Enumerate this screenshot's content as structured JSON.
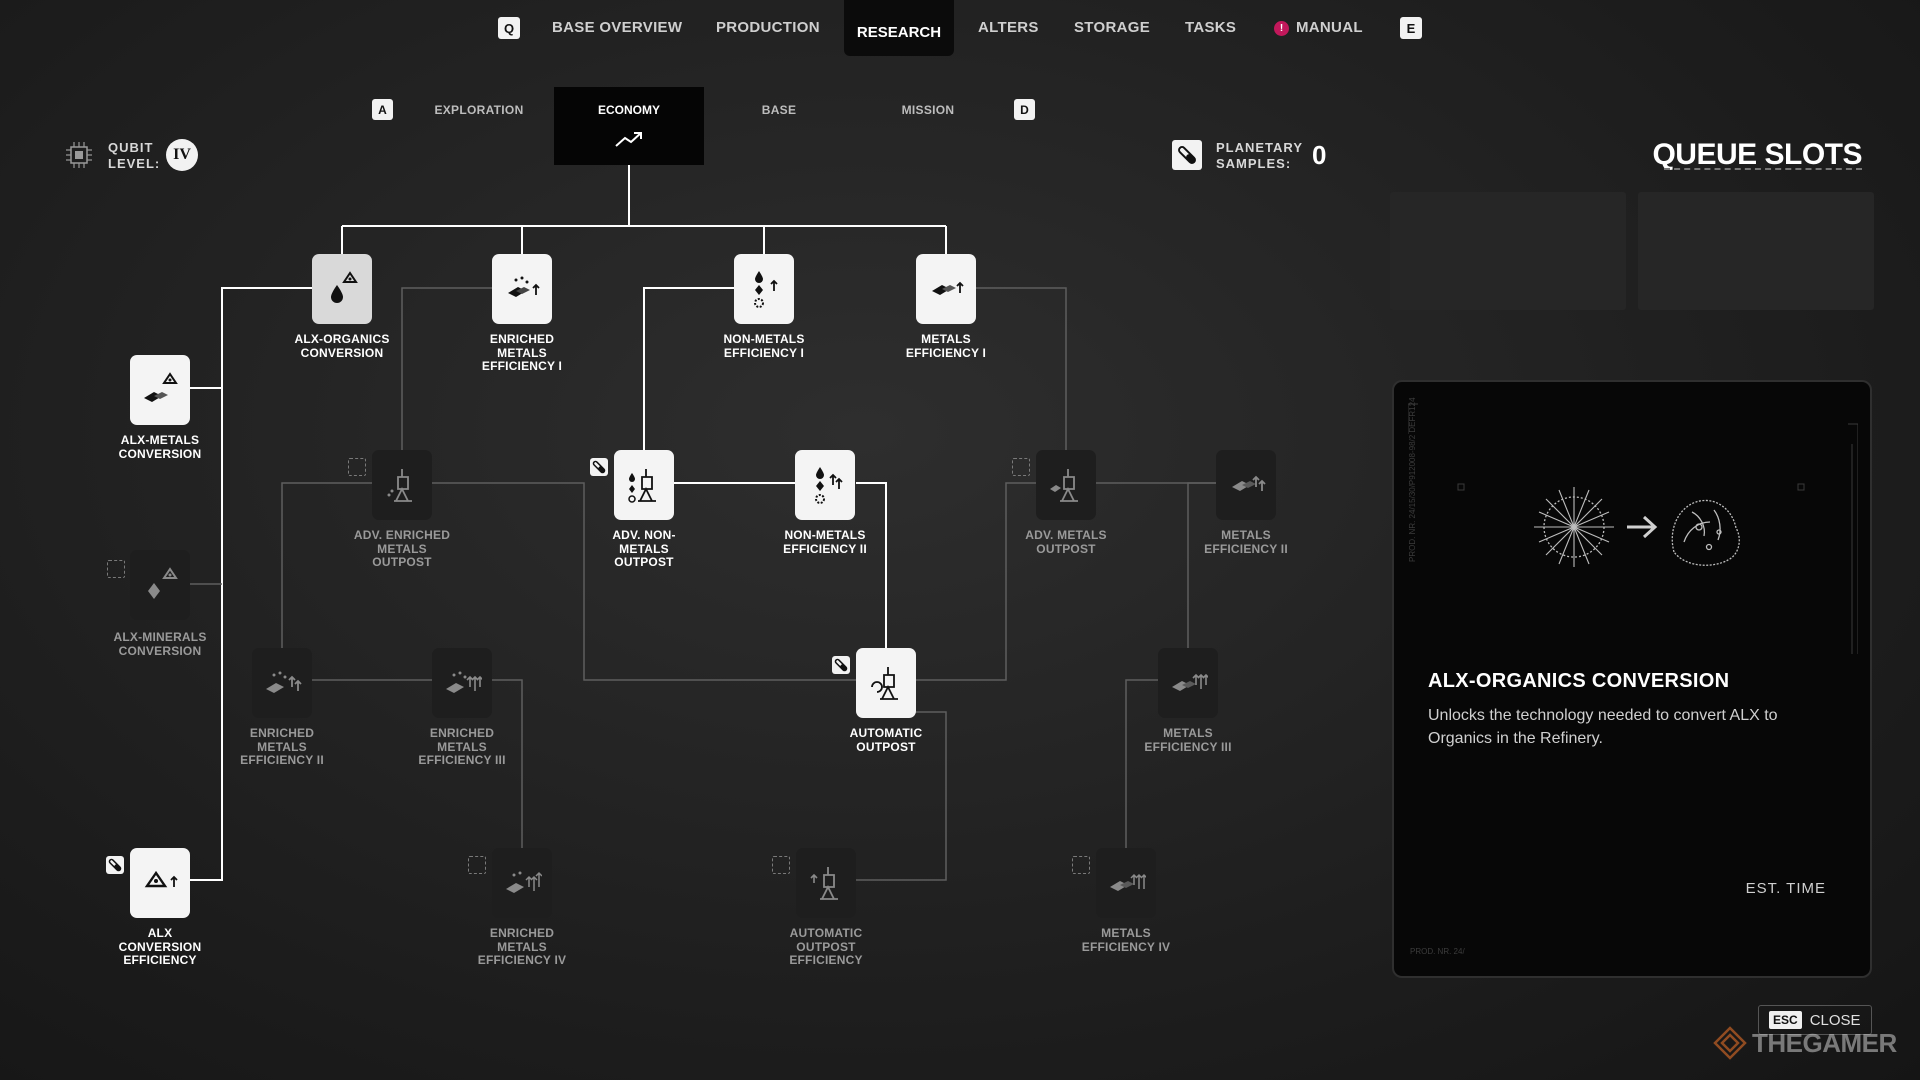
{
  "top_nav": {
    "left_key": "Q",
    "right_key": "E",
    "items": [
      "BASE OVERVIEW",
      "PRODUCTION",
      "RESEARCH",
      "ALTERS",
      "STORAGE",
      "TASKS",
      "MANUAL"
    ],
    "active": "RESEARCH",
    "manual_badge": "!"
  },
  "sub_nav": {
    "left_key": "A",
    "right_key": "D",
    "items": [
      "EXPLORATION",
      "ECONOMY",
      "BASE",
      "MISSION"
    ],
    "active": "ECONOMY"
  },
  "qubit": {
    "label": "QUBIT\nLEVEL:",
    "level": "IV"
  },
  "samples": {
    "label": "PLANETARY\nSAMPLES:",
    "count": "0"
  },
  "queue": {
    "title": "QUEUE SLOTS"
  },
  "nodes": [
    {
      "id": "alx-organics",
      "label": "ALX-ORGANICS\nCONVERSION",
      "unlocked": true,
      "selected": true,
      "icon": "organics-alx-icon"
    },
    {
      "id": "enriched-1",
      "label": "ENRICHED\nMETALS\nEFFICIENCY I",
      "unlocked": true,
      "icon": "enriched-metals-icon"
    },
    {
      "id": "nonmetals-1",
      "label": "NON-METALS\nEFFICIENCY I",
      "unlocked": true,
      "icon": "non-metals-icon"
    },
    {
      "id": "metals-1",
      "label": "METALS\nEFFICIENCY I",
      "unlocked": true,
      "icon": "metals-icon"
    },
    {
      "id": "alx-metals",
      "label": "ALX-METALS\nCONVERSION",
      "unlocked": true,
      "icon": "metals-alx-icon"
    },
    {
      "id": "adv-enriched-outpost",
      "label": "ADV. ENRICHED\nMETALS\nOUTPOST",
      "unlocked": false,
      "icon": "outpost-icon"
    },
    {
      "id": "adv-nonmetals-outpost",
      "label": "ADV. NON-\nMETALS\nOUTPOST",
      "unlocked": true,
      "icon": "outpost-icon"
    },
    {
      "id": "nonmetals-2",
      "label": "NON-METALS\nEFFICIENCY II",
      "unlocked": true,
      "icon": "non-metals-icon"
    },
    {
      "id": "adv-metals-outpost",
      "label": "ADV. METALS\nOUTPOST",
      "unlocked": false,
      "icon": "outpost-icon"
    },
    {
      "id": "metals-2",
      "label": "METALS\nEFFICIENCY II",
      "unlocked": false,
      "icon": "metals-icon"
    },
    {
      "id": "alx-minerals",
      "label": "ALX-MINERALS\nCONVERSION",
      "unlocked": false,
      "icon": "minerals-alx-icon"
    },
    {
      "id": "enriched-2",
      "label": "ENRICHED\nMETALS\nEFFICIENCY II",
      "unlocked": false,
      "icon": "enriched-metals-icon"
    },
    {
      "id": "enriched-3",
      "label": "ENRICHED\nMETALS\nEFFICIENCY III",
      "unlocked": false,
      "icon": "enriched-metals-icon"
    },
    {
      "id": "automatic-outpost",
      "label": "AUTOMATIC\nOUTPOST",
      "unlocked": true,
      "icon": "outpost-icon"
    },
    {
      "id": "metals-3",
      "label": "METALS\nEFFICIENCY III",
      "unlocked": false,
      "icon": "metals-icon"
    },
    {
      "id": "alx-efficiency",
      "label": "ALX\nCONVERSION\nEFFICIENCY",
      "unlocked": true,
      "icon": "alx-efficiency-icon"
    },
    {
      "id": "enriched-4",
      "label": "ENRICHED\nMETALS\nEFFICIENCY IV",
      "unlocked": false,
      "icon": "enriched-metals-icon"
    },
    {
      "id": "auto-outpost-eff",
      "label": "AUTOMATIC\nOUTPOST\nEFFICIENCY",
      "unlocked": false,
      "icon": "outpost-icon"
    },
    {
      "id": "metals-4",
      "label": "METALS\nEFFICIENCY IV",
      "unlocked": false,
      "icon": "metals-icon"
    }
  ],
  "detail": {
    "title": "ALX-ORGANICS CONVERSION",
    "description": "Unlocks the technology needed to convert ALX to Organics in the Refinery.",
    "est_time_label": "EST. TIME",
    "side_text": "PROD. NR. 24/15/30/P912008-98/2 DEFR124",
    "footer_text": "PROD. NR. 24/"
  },
  "close": {
    "key": "ESC",
    "label": "CLOSE"
  },
  "watermark": "THEGAMER"
}
